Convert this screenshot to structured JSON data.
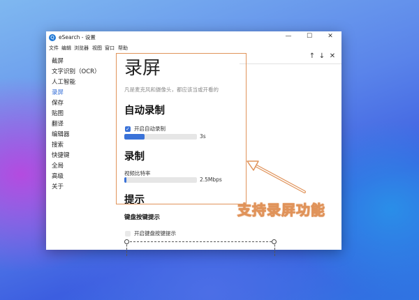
{
  "window": {
    "title": "eSearch - 设置",
    "app_icon_glyph": "Q",
    "controls": {
      "minimize": "—",
      "maximize": "☐",
      "close": "✕"
    }
  },
  "menu": [
    "文件",
    "编辑",
    "浏览器",
    "视图",
    "窗口",
    "帮助"
  ],
  "sidebar": {
    "items": [
      "截屏",
      "文字识别（OCR）",
      "人工智能",
      "录屏",
      "保存",
      "贴图",
      "翻译",
      "编辑器",
      "搜索",
      "快捷键",
      "全局",
      "高级",
      "关于"
    ],
    "active_index": 3,
    "active_color": "#3a72d8"
  },
  "search_nav": {
    "up": "↑",
    "down": "↓",
    "close": "✕"
  },
  "main": {
    "heading": "录屏",
    "description": "凡是麦克风和摄像头，都应该当或开看的",
    "auto_record": {
      "title": "自动录制",
      "checkbox_label": "开启自动录制",
      "checked": true,
      "slider_value": "3s",
      "slider_fraction": 0.28
    },
    "record": {
      "title": "录制",
      "bitrate_label": "视频比特率",
      "bitrate_value": "2.5Mbps",
      "slider_fraction": 0.03
    },
    "tips": {
      "title": "提示",
      "keyboard_title": "键盘按键提示",
      "checkbox_label": "开启键盘按键提示",
      "checked": false
    }
  },
  "annotation": {
    "callout": "支持录屏功能",
    "color": "#e0935a"
  }
}
